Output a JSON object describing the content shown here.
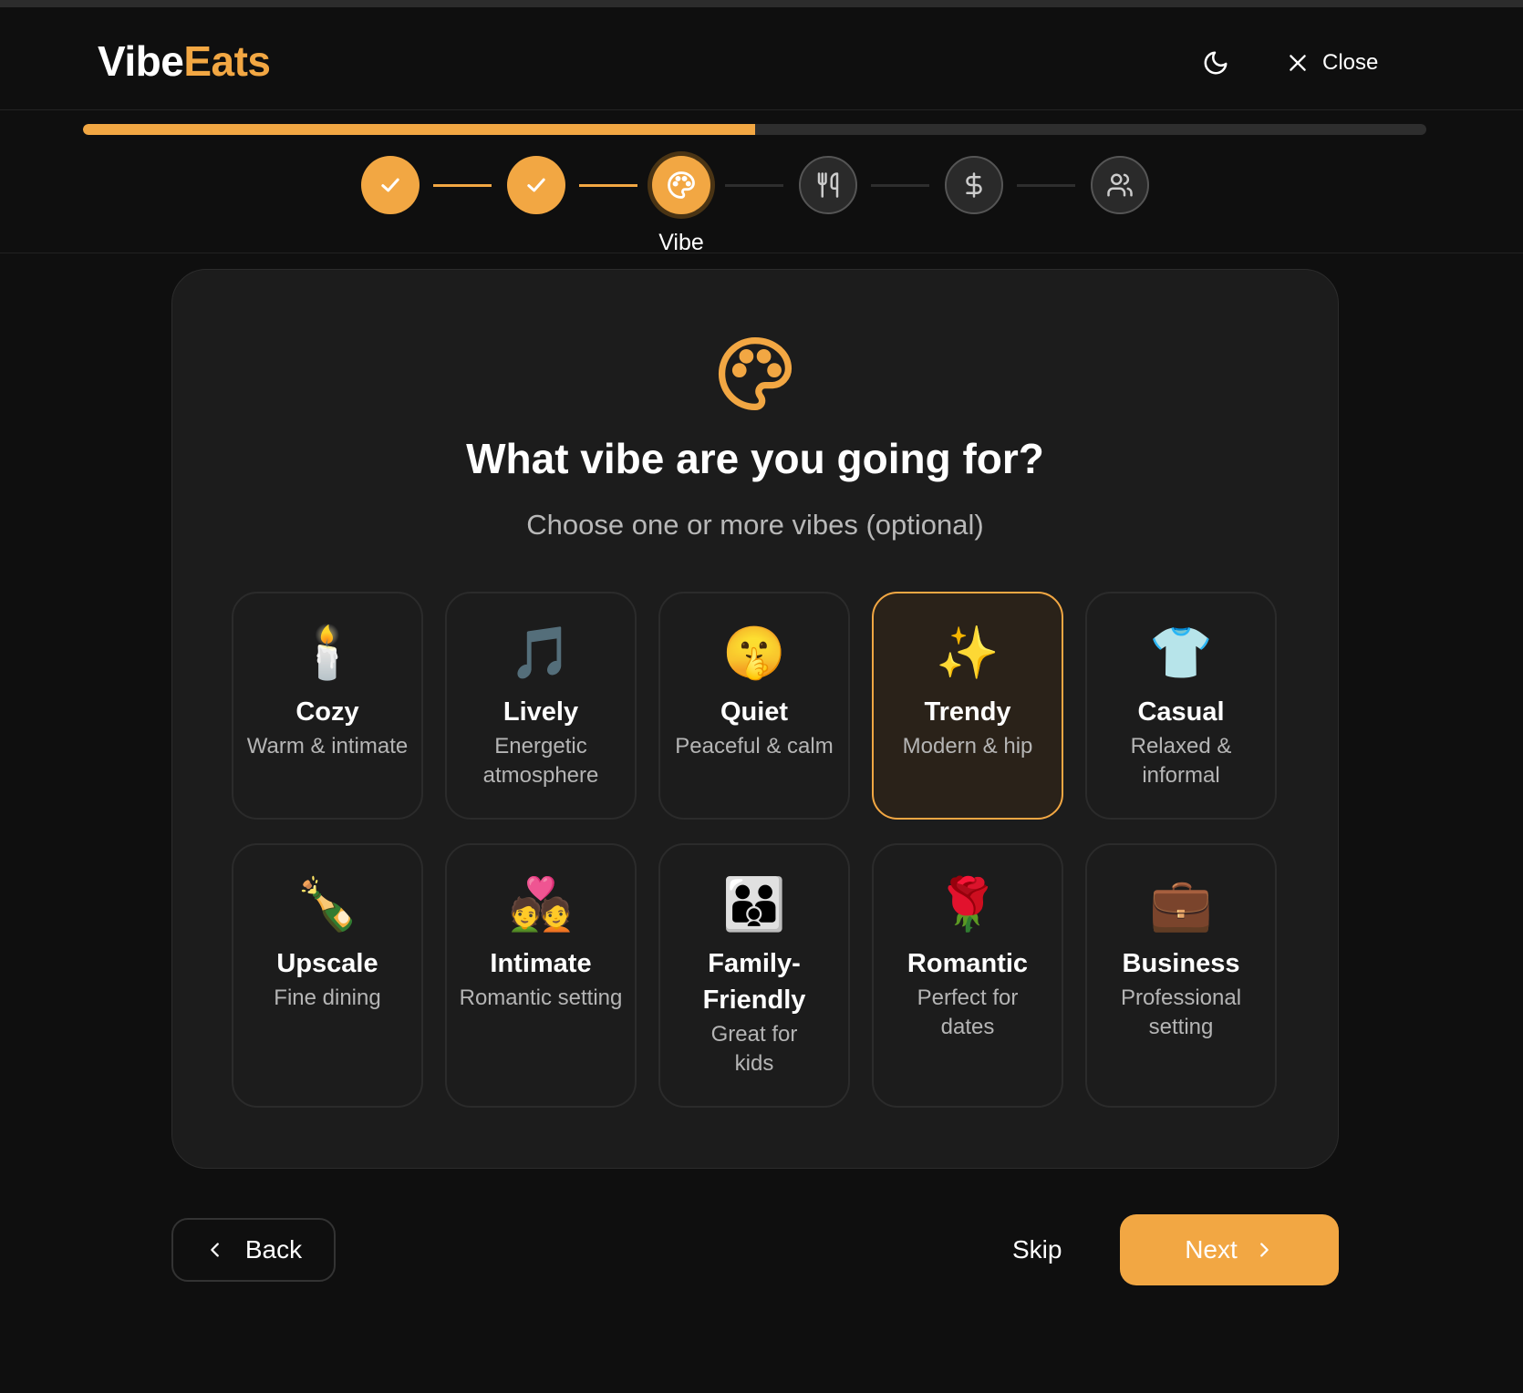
{
  "app": {
    "logo_part1": "Vibe",
    "logo_part2": "Eats",
    "close_label": "Close",
    "accent_color": "#f2a743"
  },
  "progress": {
    "fraction": 0.5
  },
  "steps": [
    {
      "status": "done",
      "icon": "check-icon"
    },
    {
      "status": "done",
      "icon": "check-icon"
    },
    {
      "status": "current",
      "icon": "palette-icon",
      "label": "Vibe"
    },
    {
      "status": "todo",
      "icon": "utensils-icon"
    },
    {
      "status": "todo",
      "icon": "dollar-icon"
    },
    {
      "status": "todo",
      "icon": "users-icon"
    }
  ],
  "main": {
    "title": "What vibe are you going for?",
    "subtitle": "Choose one or more vibes (optional)"
  },
  "vibes": [
    {
      "emoji": "🕯️",
      "name": "Cozy",
      "desc": "Warm & intimate",
      "selected": false
    },
    {
      "emoji": "🎵",
      "name": "Lively",
      "desc": "Energetic atmosphere",
      "selected": false
    },
    {
      "emoji": "🤫",
      "name": "Quiet",
      "desc": "Peaceful & calm",
      "selected": false
    },
    {
      "emoji": "✨",
      "name": "Trendy",
      "desc": "Modern & hip",
      "selected": true
    },
    {
      "emoji": "👕",
      "name": "Casual",
      "desc": "Relaxed & informal",
      "selected": false
    },
    {
      "emoji": "🍾",
      "name": "Upscale",
      "desc": "Fine dining",
      "selected": false
    },
    {
      "emoji": "💑",
      "name": "Intimate",
      "desc": "Romantic setting",
      "selected": false
    },
    {
      "emoji": "👪",
      "name": "Family-Friendly",
      "desc": "Great for kids",
      "selected": false
    },
    {
      "emoji": "🌹",
      "name": "Romantic",
      "desc": "Perfect for dates",
      "selected": false
    },
    {
      "emoji": "💼",
      "name": "Business",
      "desc": "Professional setting",
      "selected": false
    }
  ],
  "footer": {
    "back_label": "Back",
    "skip_label": "Skip",
    "next_label": "Next"
  }
}
